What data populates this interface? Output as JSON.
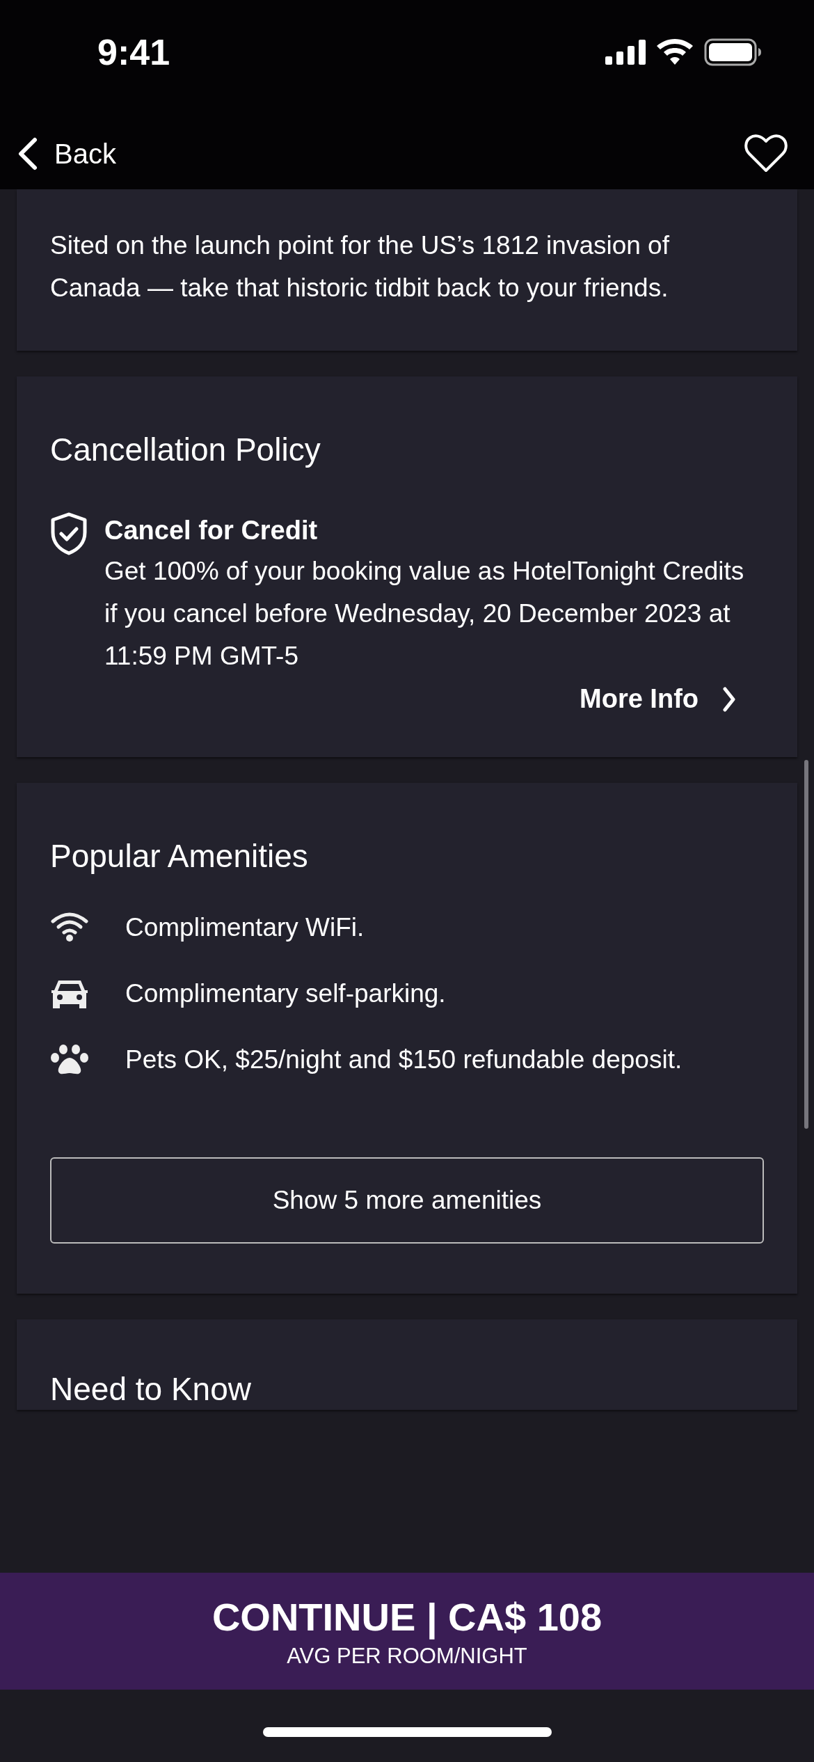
{
  "status_bar": {
    "time": "9:41"
  },
  "nav": {
    "back_label": "Back"
  },
  "about": {
    "text": "Sited on the launch point for the US’s 1812 invasion of Canada — take that historic tidbit back to your friends."
  },
  "cancellation": {
    "title": "Cancellation Policy",
    "policy_title": "Cancel for Credit",
    "policy_text": "Get 100% of your booking value as HotelTonight Credits if you cancel before Wednesday, 20 December 2023 at 11:59 PM GMT-5",
    "more_info": "More Info"
  },
  "amenities": {
    "title": "Popular Amenities",
    "items": [
      {
        "kind": "wifi",
        "text": "Complimentary WiFi."
      },
      {
        "kind": "car",
        "text": "Complimentary self-parking."
      },
      {
        "kind": "paw",
        "text": "Pets OK, $25/night and $150 refundable deposit."
      }
    ],
    "show_more": "Show 5 more amenities"
  },
  "need_to_know": {
    "title": "Need to Know"
  },
  "continue_bar": {
    "label": "CONTINUE | CA$ 108",
    "sublabel": "AVG PER ROOM/NIGHT"
  }
}
